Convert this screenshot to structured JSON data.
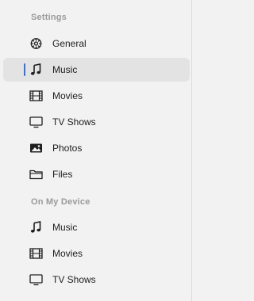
{
  "sidebar": {
    "sections": [
      {
        "header": "Settings",
        "items": [
          {
            "label": "General",
            "icon": "gear-icon",
            "selected": false
          },
          {
            "label": "Music",
            "icon": "music-note-icon",
            "selected": true
          },
          {
            "label": "Movies",
            "icon": "film-icon",
            "selected": false
          },
          {
            "label": "TV Shows",
            "icon": "tv-icon",
            "selected": false
          },
          {
            "label": "Photos",
            "icon": "photo-icon",
            "selected": false
          },
          {
            "label": "Files",
            "icon": "folder-icon",
            "selected": false
          }
        ]
      },
      {
        "header": "On My Device",
        "items": [
          {
            "label": "Music",
            "icon": "music-note-icon",
            "selected": false
          },
          {
            "label": "Movies",
            "icon": "film-icon",
            "selected": false
          },
          {
            "label": "TV Shows",
            "icon": "tv-icon",
            "selected": false
          }
        ]
      }
    ],
    "colors": {
      "accent": "#2f73e6",
      "selected_background": "#e4e3e3",
      "background": "#f3f2f2"
    }
  }
}
